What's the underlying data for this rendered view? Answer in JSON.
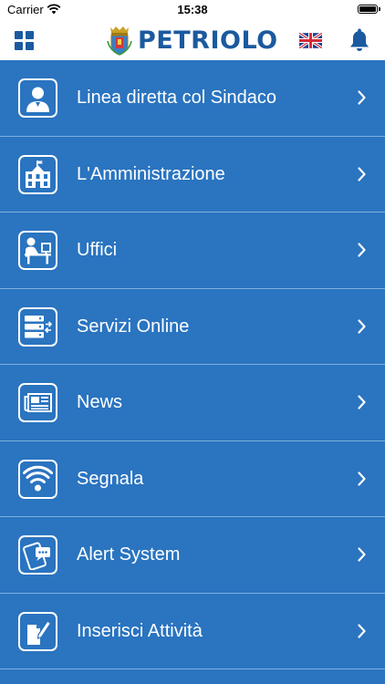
{
  "status_bar": {
    "carrier": "Carrier",
    "time": "15:38"
  },
  "header": {
    "title": "PETRIOLO",
    "menu_icon": "grid-icon",
    "language_icon": "uk-flag-icon",
    "notifications_icon": "bell-icon"
  },
  "colors": {
    "brand_blue": "#1b5a9f",
    "menu_background": "#2a74c0",
    "divider": "#7fb0e0"
  },
  "menu": {
    "items": [
      {
        "label": "Linea diretta col Sindaco",
        "icon": "mayor-person-icon"
      },
      {
        "label": "L'Amministrazione",
        "icon": "town-hall-icon"
      },
      {
        "label": "Uffici",
        "icon": "office-desk-icon"
      },
      {
        "label": "Servizi Online",
        "icon": "server-sync-icon"
      },
      {
        "label": "News",
        "icon": "newspaper-icon"
      },
      {
        "label": "Segnala",
        "icon": "wifi-signal-icon"
      },
      {
        "label": "Alert System",
        "icon": "phone-chat-icon"
      },
      {
        "label": "Inserisci Attività",
        "icon": "document-edit-icon"
      }
    ]
  }
}
